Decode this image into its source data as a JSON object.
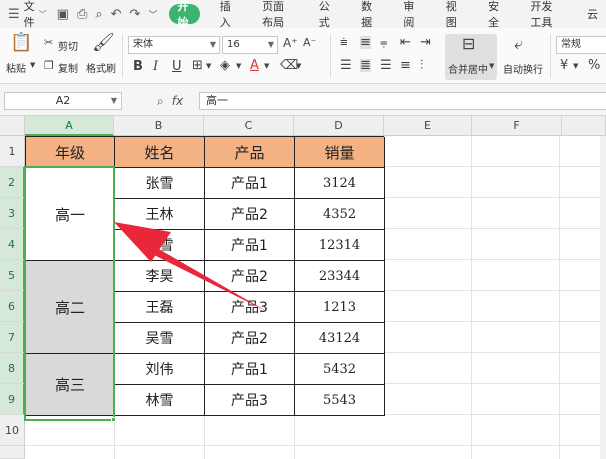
{
  "menu": {
    "file_label": "文件",
    "tabs": [
      "开始",
      "插入",
      "页面布局",
      "公式",
      "数据",
      "审阅",
      "视图",
      "安全",
      "开发工具",
      "云"
    ],
    "active_tab": "开始"
  },
  "ribbon": {
    "paste": "粘贴",
    "cut": "剪切",
    "copy": "复制",
    "format_painter": "格式刷",
    "font_name": "宋体",
    "font_size": "16",
    "merge_center": "合并居中",
    "wrap_text": "自动换行",
    "number_format": "常规"
  },
  "formula_bar": {
    "cell_ref": "A2",
    "fx": "fx",
    "content": "高一"
  },
  "columns": [
    "A",
    "B",
    "C",
    "D",
    "E",
    "F"
  ],
  "rows": [
    "1",
    "2",
    "3",
    "4",
    "5",
    "6",
    "7",
    "8",
    "9",
    "10"
  ],
  "table": {
    "headers": [
      "年级",
      "姓名",
      "产品",
      "销量"
    ],
    "grades": [
      "高一",
      "高二",
      "高三"
    ],
    "rows": [
      {
        "name": "张雪",
        "product": "产品1",
        "sales": "3124"
      },
      {
        "name": "王林",
        "product": "产品2",
        "sales": "4352"
      },
      {
        "name": "林雪",
        "product": "产品1",
        "sales": "12314"
      },
      {
        "name": "李昊",
        "product": "产品2",
        "sales": "23344"
      },
      {
        "name": "王磊",
        "product": "产品3",
        "sales": "1213"
      },
      {
        "name": "吴雪",
        "product": "产品2",
        "sales": "43124"
      },
      {
        "name": "刘伟",
        "product": "产品1",
        "sales": "5432"
      },
      {
        "name": "林雪",
        "product": "产品3",
        "sales": "5543"
      }
    ]
  },
  "colors": {
    "header_fill": "#f4b183",
    "merged_grey": "#d9d9d9",
    "selection": "#4caf50",
    "arrow": "#e8283a",
    "active_tab": "#3cb371"
  }
}
